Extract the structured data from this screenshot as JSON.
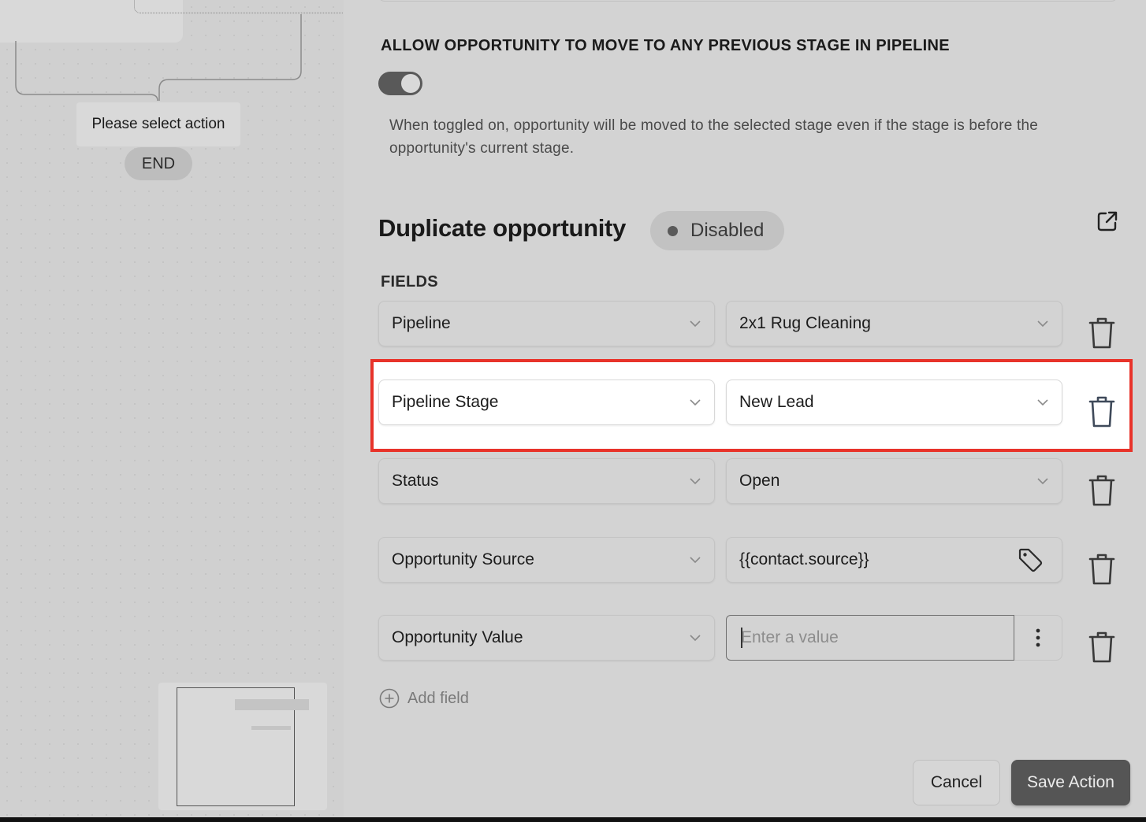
{
  "canvas": {
    "action_chip": "Please select action",
    "end_label": "END"
  },
  "panel": {
    "allow_previous_title": "ALLOW OPPORTUNITY TO MOVE TO ANY PREVIOUS STAGE IN PIPELINE",
    "allow_previous_toggle_on": true,
    "allow_previous_help": "When toggled on, opportunity will be moved to the selected stage even if the stage is before the opportunity's current stage.",
    "section_title": "Duplicate opportunity",
    "status_badge": "Disabled",
    "external_icon": "external-link-icon",
    "fields_label": "FIELDS",
    "rows": [
      {
        "field": "Pipeline",
        "value": "2x1 Rug Cleaning"
      },
      {
        "field": "Pipeline Stage",
        "value": "New Lead"
      },
      {
        "field": "Status",
        "value": "Open"
      },
      {
        "field": "Opportunity Source",
        "value": "{{contact.source}}"
      },
      {
        "field": "Opportunity Value",
        "value": "",
        "placeholder": "Enter a value"
      }
    ],
    "add_field_label": "Add field",
    "cancel_label": "Cancel",
    "save_label": "Save Action"
  },
  "colors": {
    "highlight_border": "#e8332a",
    "save_button": "#555555",
    "toggle_on": "#595959"
  }
}
